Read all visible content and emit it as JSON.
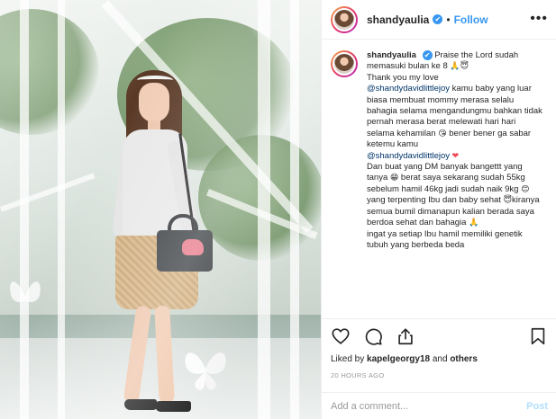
{
  "post": {
    "username": "shandyaulia",
    "verified_mark": "✔",
    "separator": "•",
    "follow_label": "Follow",
    "more_label": "•••",
    "photo_alt": "Instagram post photo"
  },
  "caption": {
    "username": "shandyaulia",
    "p1": "Praise the Lord sudah memasuki bulan ke 8",
    "e1": "🙏😇",
    "p2": "Thank you my love",
    "m1": "@shandydavidlittlejoy",
    "p3": "kamu baby yang luar biasa membuat mommy merasa selalu bahagia selama mengandungmu bahkan tidak pernah merasa berat melewati hari hari selama kehamilan",
    "e2": "😘",
    "p4": "bener bener ga sabar ketemu kamu",
    "m2": "@shandydavidlittlejoy",
    "e3": "❤",
    "p5": "Dan buat yang DM banyak bangettt yang tanya",
    "e4": "😁",
    "p6": "berat saya sekarang sudah 55kg sebelum hamil 46kg jadi sudah naik 9kg",
    "e5": "😊",
    "p7": "yang terpenting Ibu dan baby sehat",
    "e6": "😇",
    "p8": "kiranya semua bumil dimanapun kalian berada saya berdoa sehat dan bahagia",
    "e7": "🙏",
    "p9": "ingat ya setiap Ibu hamil memiliki genetik tubuh yang berbeda beda"
  },
  "actions": {
    "liked_prefix": "Liked by",
    "liked_user": "kapelgeorgy18",
    "liked_and": "and",
    "liked_others": "others",
    "timestamp": "20 HOURS AGO"
  },
  "comment": {
    "placeholder": "Add a comment...",
    "post_label": "Post"
  },
  "colors": {
    "accent": "#3897f0",
    "text": "#262626",
    "muted": "#999999",
    "border": "#efefef",
    "like": "#ed4956"
  },
  "icons": [
    "heart-icon",
    "comment-icon",
    "share-icon",
    "bookmark-icon",
    "more-icon",
    "verified-badge-icon"
  ]
}
